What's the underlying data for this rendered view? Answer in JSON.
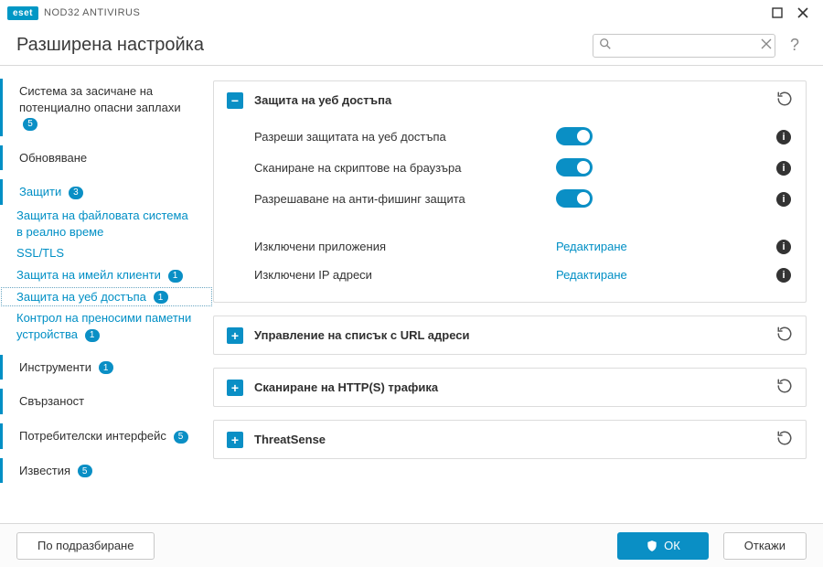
{
  "titlebar": {
    "brand": "eset",
    "product": "NOD32 ANTIVIRUS"
  },
  "header": {
    "title": "Разширена настройка",
    "search_placeholder": ""
  },
  "sidebar": {
    "items": [
      {
        "label": "Система за засичане на потенциално опасни заплахи",
        "badge": "5",
        "bar": true
      },
      {
        "label": "Обновяване",
        "bar": true
      },
      {
        "label": "Защити",
        "badge": "3",
        "bar": true,
        "active": true,
        "children": [
          {
            "label": "Защита на файловата система в реално време"
          },
          {
            "label": "SSL/TLS"
          },
          {
            "label": "Защита на имейл клиенти",
            "badge": "1"
          },
          {
            "label": "Защита на уеб достъпа",
            "badge": "1",
            "selected": true
          },
          {
            "label": "Контрол на преносими паметни устройства",
            "badge": "1"
          }
        ]
      },
      {
        "label": "Инструменти",
        "badge": "1",
        "bar": true
      },
      {
        "label": "Свързаност",
        "bar": true
      },
      {
        "label": "Потребителски интерфейс",
        "badge": "5",
        "bar": true
      },
      {
        "label": "Известия",
        "badge": "5",
        "bar": true
      }
    ]
  },
  "panels": {
    "open": {
      "title": "Защита на уеб достъпа",
      "rows": [
        {
          "label": "Разреши защитата на уеб достъпа",
          "kind": "toggle",
          "on": true
        },
        {
          "label": "Сканиране на скриптове на браузъра",
          "kind": "toggle",
          "on": true
        },
        {
          "label": "Разрешаване на анти-фишинг защита",
          "kind": "toggle",
          "on": true
        }
      ],
      "edits": [
        {
          "label": "Изключени приложения",
          "action": "Редактиране"
        },
        {
          "label": "Изключени IP адреси",
          "action": "Редактиране"
        }
      ]
    },
    "closed": [
      {
        "title": "Управление на списък с URL адреси"
      },
      {
        "title": "Сканиране на HTTP(S) трафика"
      },
      {
        "title": "ThreatSense"
      }
    ]
  },
  "footer": {
    "defaults": "По подразбиране",
    "ok": "ОК",
    "cancel": "Откажи"
  }
}
